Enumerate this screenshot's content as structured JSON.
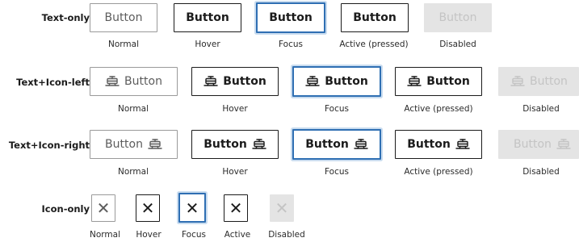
{
  "row_labels": {
    "text_only": "Text-only",
    "text_icon_left": "Text+Icon-left",
    "text_icon_right": "Text+Icon-right",
    "icon_only": "Icon-only"
  },
  "button_label": "Button",
  "states": [
    "Normal",
    "Hover",
    "Focus",
    "Active (pressed)",
    "Disabled"
  ],
  "icon_only_states": [
    "Normal",
    "Hover",
    "Focus",
    "Active",
    "Disabled"
  ],
  "icons": {
    "tram": "tram-icon",
    "close": "close-icon"
  },
  "icon_only_glyph": "✕",
  "colors": {
    "border_normal": "#9a9a9a",
    "border_dark": "#1b1b1b",
    "focus": "#2f6fb3",
    "disabled_bg": "#e4e4e4",
    "disabled_text": "#c4c4c4"
  }
}
